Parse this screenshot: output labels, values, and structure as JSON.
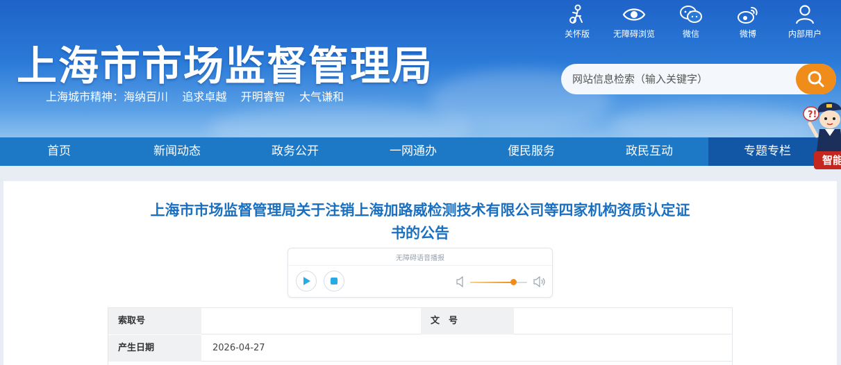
{
  "header": {
    "site_title": "上海市市场监督管理局",
    "slogan": "上海城市精神：海纳百川    追求卓越    开明睿智    大气谦和",
    "tools": [
      {
        "label": "关怀版",
        "icon": "care-icon"
      },
      {
        "label": "无障碍浏览",
        "icon": "eye-icon"
      },
      {
        "label": "微信",
        "icon": "wechat-icon"
      },
      {
        "label": "微博",
        "icon": "weibo-icon"
      },
      {
        "label": "内部用户",
        "icon": "user-icon"
      }
    ],
    "search": {
      "placeholder": "网站信息检索（输入关键字）",
      "icon": "search-icon"
    }
  },
  "nav": {
    "items": [
      "首页",
      "新闻动态",
      "政务公开",
      "一网通办",
      "便民服务",
      "政民互动",
      "专题专栏"
    ],
    "active_index": 6
  },
  "assistant": {
    "label": "智能"
  },
  "article": {
    "title": "上海市市场监督管理局关于注销上海加路威检测技术有限公司等四家机构资质认定证书的公告",
    "title_line1": "上海市市场监督管理局关于注销上海加路威检测技术有限公司等四家机构资质认定证",
    "title_line2": "书的公告",
    "player": {
      "label": "无障碍语音播报",
      "volume_fraction": 0.75
    },
    "meta": {
      "index_label": "索取号",
      "index_value": "",
      "doc_no_label": "文　号",
      "doc_no_value": "",
      "date_label": "产生日期",
      "date_value": "2026-04-27"
    }
  },
  "colors": {
    "header_blue": "#1f63c8",
    "nav_blue": "#1d78c6",
    "nav_active": "#1257a5",
    "title_blue": "#1a6fbf",
    "accent_orange": "#f08c1a"
  }
}
